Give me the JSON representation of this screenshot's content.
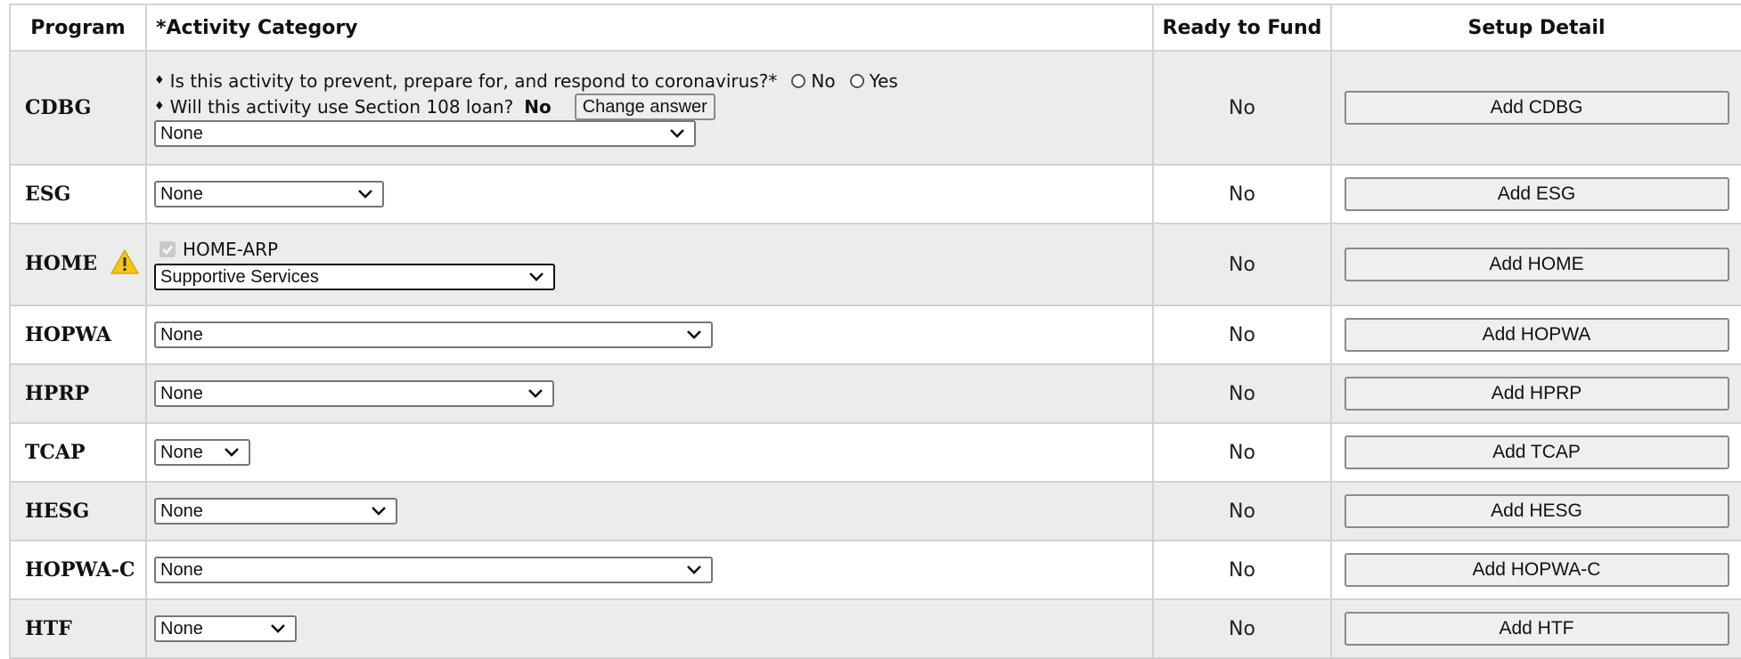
{
  "header": {
    "program": "Program",
    "activity_category": "*Activity Category",
    "ready_to_fund": "Ready to Fund",
    "setup_detail": "Setup Detail"
  },
  "cdbg": {
    "program": "CDBG",
    "q1": "Is this activity to prevent, prepare for, and respond to coronavirus?*",
    "q1_opt_no": "No",
    "q1_opt_yes": "Yes",
    "q2": "Will this activity use Section 108 loan?",
    "q2_answer": "No",
    "change_answer": "Change answer",
    "category": "None",
    "ready": "No",
    "add": "Add CDBG"
  },
  "esg": {
    "program": "ESG",
    "category": "None",
    "ready": "No",
    "add": "Add ESG"
  },
  "home": {
    "program": "HOME",
    "warning_icon": "warning-icon",
    "home_arp_label": "HOME-ARP",
    "home_arp_checked": true,
    "category": "Supportive Services",
    "ready": "No",
    "add": "Add HOME"
  },
  "hopwa": {
    "program": "HOPWA",
    "category": "None",
    "ready": "No",
    "add": "Add HOPWA"
  },
  "hprp": {
    "program": "HPRP",
    "category": "None",
    "ready": "No",
    "add": "Add HPRP"
  },
  "tcap": {
    "program": "TCAP",
    "category": "None",
    "ready": "No",
    "add": "Add TCAP"
  },
  "hesg": {
    "program": "HESG",
    "category": "None",
    "ready": "No",
    "add": "Add HESG"
  },
  "hopwa_c": {
    "program": "HOPWA-C",
    "category": "None",
    "ready": "No",
    "add": "Add HOPWA-C"
  },
  "htf": {
    "program": "HTF",
    "category": "None",
    "ready": "No",
    "add": "Add HTF"
  },
  "colors": {
    "row_shaded": "#ececec",
    "border": "#d2d2d2",
    "warning": "#f5c518"
  }
}
